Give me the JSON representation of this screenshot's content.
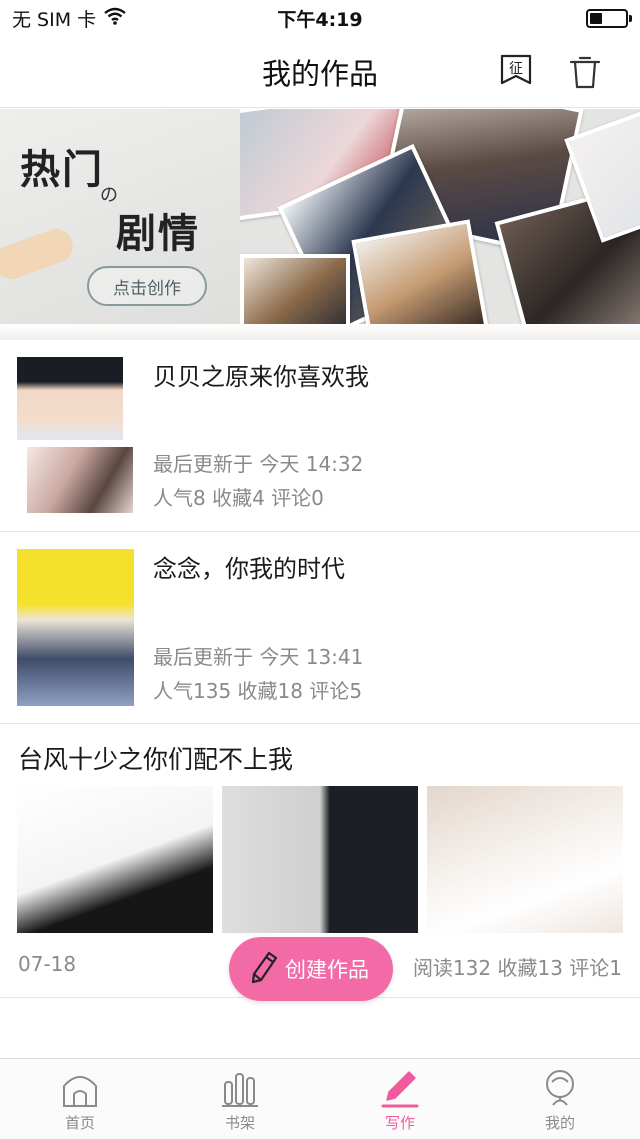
{
  "status_bar": {
    "carrier": "无 SIM 卡",
    "time": "下午4:19",
    "icons": [
      "wifi-icon",
      "battery-icon"
    ]
  },
  "nav": {
    "title": "我的作品",
    "badge_icon_text": "征",
    "icons": [
      "badge-icon",
      "trash-icon"
    ]
  },
  "banner": {
    "title_line1": "热门",
    "title_connector": "の",
    "title_line2": "剧情",
    "button_label": "点击创作"
  },
  "works": [
    {
      "title": "贝贝之原来你喜欢我",
      "updated": "最后更新于 今天 14:32",
      "stats": "人气8 收藏4 评论0"
    },
    {
      "title": "念念，你我的时代",
      "updated": "最后更新于 今天 13:41",
      "stats": "人气135 收藏18 评论5"
    },
    {
      "title": "台风十少之你们配不上我",
      "date": "07-18",
      "stats": "阅读132 收藏13 评论1"
    }
  ],
  "create_button": {
    "label": "创建作品",
    "icon": "pencil-icon",
    "color": "#f26aa6"
  },
  "tabs": [
    {
      "label": "首页",
      "icon": "home-icon"
    },
    {
      "label": "书架",
      "icon": "bookshelf-icon"
    },
    {
      "label": "写作",
      "icon": "write-icon",
      "active": true
    },
    {
      "label": "我的",
      "icon": "profile-icon"
    }
  ],
  "colors": {
    "accent": "#ef5b9c",
    "muted_text": "#8a8a8a"
  }
}
